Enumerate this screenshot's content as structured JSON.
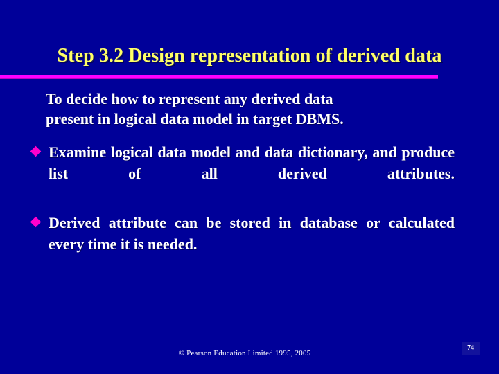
{
  "slide": {
    "background_color": "#000099",
    "title": "Step 3.2  Design representation of derived data",
    "title_color": "#FFFF66",
    "rule_color": "#FF00FF",
    "bullet_color": "#FF00CC",
    "text_color": "#FFFFFF"
  },
  "intro": {
    "line1": "To decide how to represent any derived data",
    "line2": "present in logical data model in target DBMS."
  },
  "bullets": [
    {
      "marker": "diamond-bullet",
      "text": "Examine logical data model and data dictionary, and produce list of all derived attributes."
    },
    {
      "marker": "diamond-bullet",
      "text": "Derived attribute can be stored in database or calculated every time it is needed."
    }
  ],
  "footer": {
    "copyright": "© Pearson Education Limited 1995, 2005",
    "page_number": "74"
  }
}
